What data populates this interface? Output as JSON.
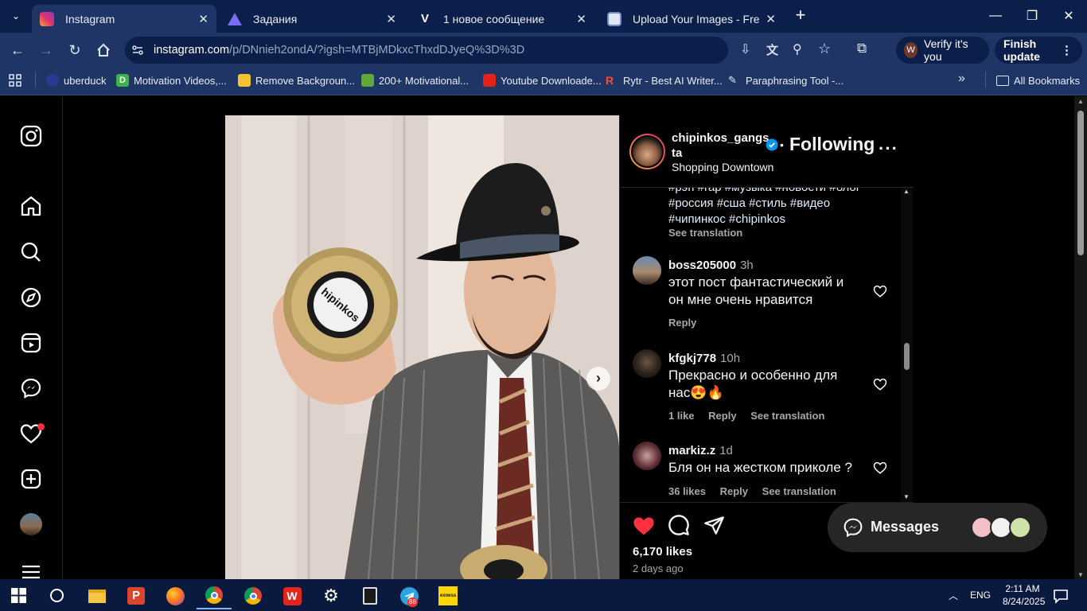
{
  "browser": {
    "tabs": [
      {
        "label": "Instagram",
        "active": true,
        "icon": "instagram-icon"
      },
      {
        "label": "Задания",
        "active": false,
        "icon": "tasks-icon"
      },
      {
        "label": "1 новое сообщение",
        "active": false,
        "icon": "v-logo-icon"
      },
      {
        "label": "Upload Your Images - Free Imag",
        "active": false,
        "icon": "upload-icon"
      }
    ],
    "url": {
      "host": "instagram.com",
      "path": "/p/DNnieh2ondA/?igsh=MTBjMDkxcThxdDJyeQ%3D%3D"
    },
    "profile_pill": "Verify it's you",
    "update_button": "Finish update",
    "bookmarks": [
      "uberduck",
      "Motivation Videos,...",
      "Remove Backgroun...",
      "200+ Motivational...",
      "Youtube Downloade...",
      "Rytr - Best AI Writer...",
      "Paraphrasing Tool -..."
    ],
    "all_bookmarks": "All Bookmarks"
  },
  "post": {
    "username": "chipinkos_gangs ta",
    "username_line1": "chipinkos_gangs",
    "username_line2": "ta",
    "location": "Shopping Downtown",
    "follow_label": "Following",
    "dot": "•",
    "caption_hashtags_1": "#рэп #rap #музыка #новости #блог",
    "caption_hashtags_2": "#россия #сша #стиль #видео",
    "caption_hashtags_3": "#чипинкос #chipinkos",
    "see_translation": "See translation",
    "comments": [
      {
        "user": "boss205000",
        "time": "3h",
        "text1": "этот пост фантастический и",
        "text2": "он мне очень нравится",
        "meta": [
          "Reply"
        ]
      },
      {
        "user": "kfgkj778",
        "time": "10h",
        "text1": "Прекрасно и особенно для",
        "text2": "нас😍🔥",
        "meta": [
          "1 like",
          "Reply",
          "See translation"
        ]
      },
      {
        "user": "markiz.z",
        "time": "1d",
        "text1": "Бля он на жестком приколе ?",
        "text2": "",
        "meta": [
          "36 likes",
          "Reply",
          "See translation"
        ]
      }
    ],
    "likes": "6,170 likes",
    "posted": "2 days ago",
    "photo_text": "hipinkos"
  },
  "messages": {
    "label": "Messages"
  },
  "system": {
    "time": "2:11 AM",
    "date": "8/24/2025",
    "lang": "ENG",
    "telegram_badge": "88"
  },
  "colors": {
    "accent": "#0095f6",
    "like_red": "#ff3040",
    "chrome_dark": "#0c1f4a",
    "chrome_mid": "#1f3566"
  }
}
